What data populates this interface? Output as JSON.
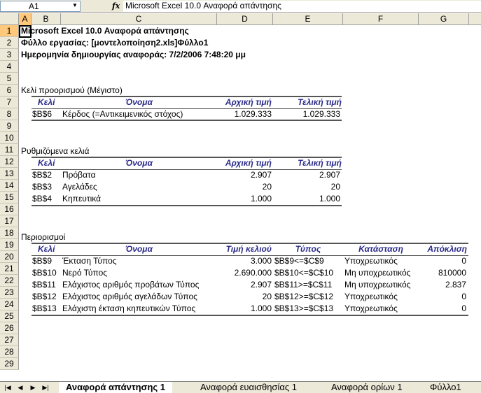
{
  "formula_bar": {
    "cell_ref": "A1",
    "fx_label": "fx",
    "content": "Microsoft Excel 10.0 Αναφορά απάντησης"
  },
  "columns": [
    "A",
    "B",
    "C",
    "D",
    "E",
    "F",
    "G"
  ],
  "rows": [
    "1",
    "2",
    "3",
    "4",
    "5",
    "6",
    "7",
    "8",
    "9",
    "10",
    "11",
    "12",
    "13",
    "14",
    "15",
    "16",
    "17",
    "18",
    "19",
    "20",
    "21",
    "22",
    "23",
    "24",
    "25",
    "26",
    "27",
    "28",
    "29"
  ],
  "report": {
    "title_first_letter": "M",
    "title_rest": "icrosoft Excel 10.0 Αναφορά απάντησης",
    "worksheet": "Φύλλο εργασίας: [μοντελοποίηση2.xls]Φύλλο1",
    "created": "Ημερομηνία δημιουργίας αναφοράς: 7/2/2006 7:48:20 μμ"
  },
  "target_cell": {
    "section_title": "Κελί προορισμού (Μέγιστο)",
    "headers": {
      "cell": "Κελί",
      "name": "Όνομα",
      "initial": "Αρχική τιμή",
      "final": "Τελική τιμή"
    },
    "rows": [
      {
        "cell": "$B$6",
        "name": "Κέρδος (=Αντικειμενικός στόχος)",
        "initial": "1.029.333",
        "final": "1.029.333"
      }
    ]
  },
  "adjustable_cells": {
    "section_title": "Ρυθμιζόμενα κελιά",
    "headers": {
      "cell": "Κελί",
      "name": "Όνομα",
      "initial": "Αρχική τιμή",
      "final": "Τελική τιμή"
    },
    "rows": [
      {
        "cell": "$B$2",
        "name": "Πρόβατα",
        "initial": "2.907",
        "final": "2.907"
      },
      {
        "cell": "$B$3",
        "name": "Αγελάδες",
        "initial": "20",
        "final": "20"
      },
      {
        "cell": "$B$4",
        "name": "Κηπευτικά",
        "initial": "1.000",
        "final": "1.000"
      }
    ]
  },
  "constraints": {
    "section_title": "Περιορισμοί",
    "headers": {
      "cell": "Κελί",
      "name": "Όνομα",
      "value": "Τιμή κελιού",
      "type": "Τύπος",
      "status": "Κατάσταση",
      "slack": "Απόκλιση"
    },
    "rows": [
      {
        "cell": "$B$9",
        "name": "Έκταση Τύπος",
        "value": "3.000",
        "type": "$B$9<=$C$9",
        "status": "Υποχρεωτικός",
        "slack": "0"
      },
      {
        "cell": "$B$10",
        "name": "Νερό Τύπος",
        "value": "2.690.000",
        "type": "$B$10<=$C$10",
        "status": "Μη υποχρεωτικός",
        "slack": "810000"
      },
      {
        "cell": "$B$11",
        "name": "Ελάχιστος αριθμός προβάτων Τύπος",
        "value": "2.907",
        "type": "$B$11>=$C$11",
        "status": "Μη υποχρεωτικός",
        "slack": "2.837"
      },
      {
        "cell": "$B$12",
        "name": "Ελάχιστος αριθμός αγελάδων Τύπος",
        "value": "20",
        "type": "$B$12>=$C$12",
        "status": "Υποχρεωτικός",
        "slack": "0"
      },
      {
        "cell": "$B$13",
        "name": "Ελάχιστη έκταση κηπευτικών Τύπος",
        "value": "1.000",
        "type": "$B$13>=$C$13",
        "status": "Υποχρεωτικός",
        "slack": "0"
      }
    ]
  },
  "sheet_tabs": [
    {
      "label": "Αναφορά απάντησης 1",
      "active": true
    },
    {
      "label": "Αναφορά ευαισθησίας 1",
      "active": false
    },
    {
      "label": "Αναφορά ορίων 1",
      "active": false
    },
    {
      "label": "Φύλλο1",
      "active": false
    }
  ],
  "icons": [
    "dropdown-arrow-icon",
    "fx-icon",
    "first-sheet-icon",
    "prev-sheet-icon",
    "next-sheet-icon",
    "last-sheet-icon"
  ]
}
